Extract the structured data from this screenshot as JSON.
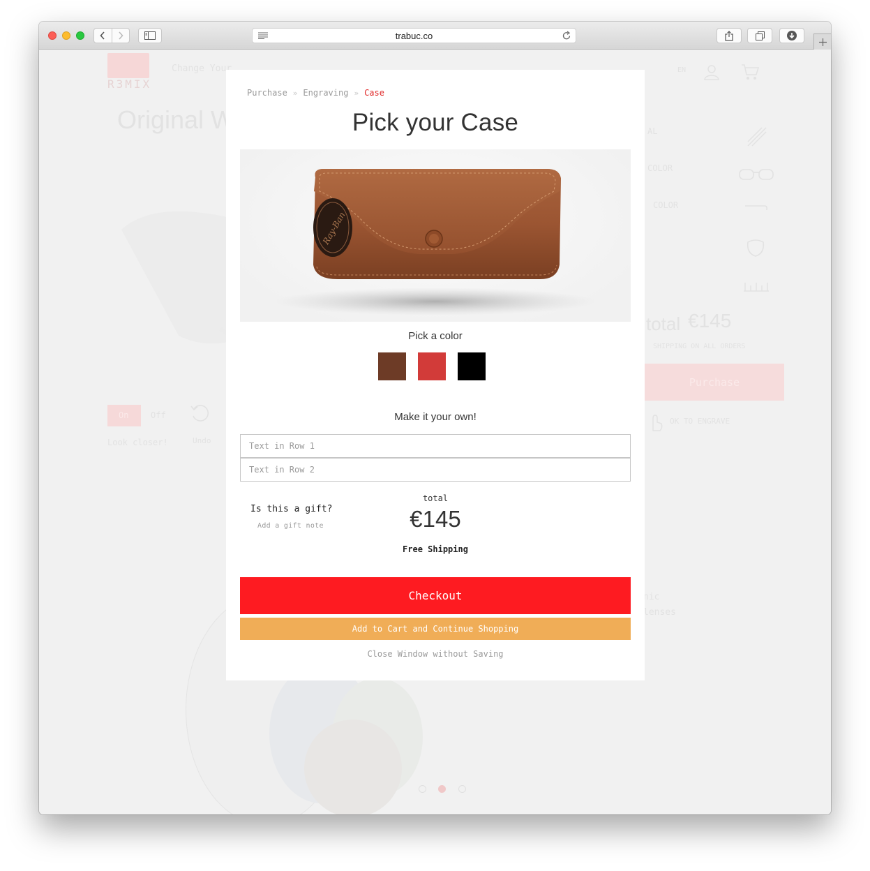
{
  "browser": {
    "url": "trabuc.co",
    "reader_icon": "reader-lines-icon",
    "reload_icon": "reload-icon",
    "share_icon": "share-icon",
    "tabs_icon": "tabs-overview-icon",
    "downloads_icon": "downloads-icon",
    "new_tab_icon": "plus-icon"
  },
  "background_page": {
    "logo_text": "R3MIX",
    "nav_text": "Change Your...",
    "product_title": "Original Wa",
    "toggle_on": "On",
    "toggle_off": "Off",
    "look_closer": "Look closer!",
    "undo": "Undo",
    "total_label": "total",
    "total_value": "€145",
    "shipping_note": "SHIPPING ON ALL ORDERS",
    "purchase_button": "Purchase",
    "engrave_note": "OK TO ENGRAVE",
    "lens_text_1": "nic",
    "lens_text_2": "lenses",
    "lang": "EN",
    "side_labels": [
      "AL",
      "COLOR",
      "COLOR"
    ]
  },
  "modal": {
    "breadcrumb": [
      {
        "label": "Purchase",
        "active": false
      },
      {
        "label": "Engraving",
        "active": false
      },
      {
        "label": "Case",
        "active": true
      }
    ],
    "breadcrumb_separator": "»",
    "title": "Pick your Case",
    "product_image": "leather-glasses-case",
    "case_brand_text": "Ray-Ban",
    "pick_color_label": "Pick a color",
    "colors": [
      {
        "name": "brown",
        "hex": "#6d3b26"
      },
      {
        "name": "red",
        "hex": "#d23b39"
      },
      {
        "name": "black",
        "hex": "#000000"
      }
    ],
    "make_own_label": "Make it your own!",
    "row1_placeholder": "Text in Row 1",
    "row1_value": "",
    "row2_placeholder": "Text in Row 2",
    "row2_value": "",
    "gift_question": "Is this a gift?",
    "gift_note_link": "Add a gift note",
    "total_label": "total",
    "total_amount": "€145",
    "shipping": "Free Shipping",
    "checkout_label": "Checkout",
    "add_to_cart_label": "Add to Cart and Continue Shopping",
    "close_label": "Close Window without Saving"
  },
  "theme": {
    "accent_red": "#fe1b21",
    "accent_orange": "#f0ad57",
    "breadcrumb_active": "#e02828"
  }
}
